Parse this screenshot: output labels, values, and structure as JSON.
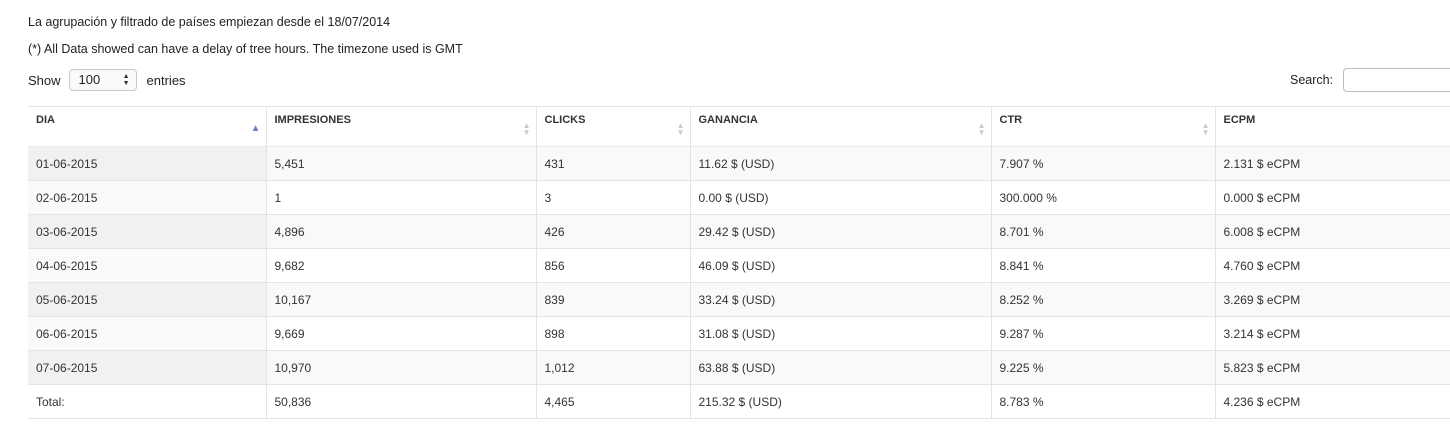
{
  "notes": {
    "line1": "La agrupación y filtrado de países empiezan desde el 18/07/2014",
    "line2": "(*) All Data showed can have a delay of tree hours. The timezone used is GMT"
  },
  "length_control": {
    "show_label": "Show",
    "selected": "100",
    "entries_label": "entries"
  },
  "search": {
    "label": "Search:",
    "value": ""
  },
  "table": {
    "columns": [
      "DIA",
      "IMPRESIONES",
      "CLICKS",
      "GANANCIA",
      "CTR",
      "ECPM"
    ],
    "rows": [
      [
        "01-06-2015",
        "5,451",
        "431",
        "11.62 $ (USD)",
        "7.907 %",
        "2.131 $ eCPM"
      ],
      [
        "02-06-2015",
        "1",
        "3",
        "0.00 $ (USD)",
        "300.000 %",
        "0.000 $ eCPM"
      ],
      [
        "03-06-2015",
        "4,896",
        "426",
        "29.42 $ (USD)",
        "8.701 %",
        "6.008 $ eCPM"
      ],
      [
        "04-06-2015",
        "9,682",
        "856",
        "46.09 $ (USD)",
        "8.841 %",
        "4.760 $ eCPM"
      ],
      [
        "05-06-2015",
        "10,167",
        "839",
        "33.24 $ (USD)",
        "8.252 %",
        "3.269 $ eCPM"
      ],
      [
        "06-06-2015",
        "9,669",
        "898",
        "31.08 $ (USD)",
        "9.287 %",
        "3.214 $ eCPM"
      ],
      [
        "07-06-2015",
        "10,970",
        "1,012",
        "63.88 $ (USD)",
        "9.225 %",
        "5.823 $ eCPM"
      ]
    ],
    "footer": [
      "Total:",
      "50,836",
      "4,465",
      "215.32 $ (USD)",
      "8.783 %",
      "4.236 $ eCPM"
    ]
  },
  "colors": {
    "sort_active": "#6d82c9",
    "sort_inactive": "#c9c9c9",
    "border": "#e4e4e4"
  }
}
